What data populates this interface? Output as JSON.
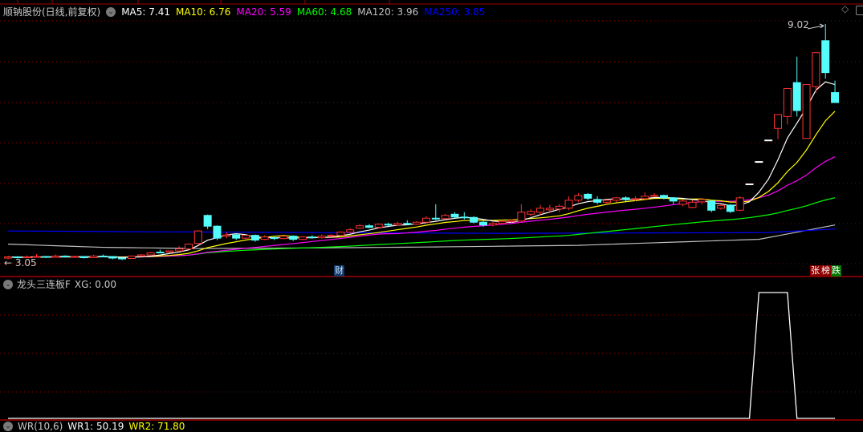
{
  "header": {
    "stock_name": "顺钠股份(日线,前复权)",
    "ma": [
      {
        "label": "MA5: 7.41",
        "color": "#ffffff"
      },
      {
        "label": "MA10: 6.76",
        "color": "#ffff00"
      },
      {
        "label": "MA20: 5.59",
        "color": "#ff00ff"
      },
      {
        "label": "MA60: 4.68",
        "color": "#00ff00"
      },
      {
        "label": "MA120: 3.96",
        "color": "#c0c0c0"
      },
      {
        "label": "MA250: 3.85",
        "color": "#0000ff"
      }
    ]
  },
  "main": {
    "high_label": "9.02",
    "low_label": "3.05",
    "finance_marker": "财",
    "tags": [
      {
        "label": "张",
        "color": "#8b0000"
      },
      {
        "label": "榜",
        "color": "#8b0000"
      },
      {
        "label": "跌",
        "color": "#007700"
      }
    ]
  },
  "sub": {
    "title": "龙头三连板F",
    "value": "XG: 0.00"
  },
  "bottom": {
    "items": [
      {
        "label": "WR(10,6)",
        "color": "#c8c8c8"
      },
      {
        "label": "WR1: 50.19",
        "color": "#ffffff"
      },
      {
        "label": "WR2: 71.80",
        "color": "#ffff00"
      }
    ]
  },
  "colors": {
    "up": "#ff3232",
    "down": "#54fcfc",
    "grid": "#8b0000"
  },
  "chart_data": {
    "type": "candlestick",
    "price_range": [
      3.05,
      9.46
    ],
    "candles_ohlc": [
      [
        3.15,
        3.2,
        3.12,
        3.18
      ],
      [
        3.18,
        3.2,
        3.14,
        3.16
      ],
      [
        3.16,
        3.22,
        3.15,
        3.18
      ],
      [
        3.18,
        3.25,
        3.16,
        3.19
      ],
      [
        3.19,
        3.2,
        3.15,
        3.17
      ],
      [
        3.17,
        3.24,
        3.16,
        3.2
      ],
      [
        3.2,
        3.22,
        3.16,
        3.18
      ],
      [
        3.18,
        3.21,
        3.17,
        3.19
      ],
      [
        3.19,
        3.2,
        3.14,
        3.16
      ],
      [
        3.16,
        3.23,
        3.15,
        3.2
      ],
      [
        3.2,
        3.24,
        3.18,
        3.19
      ],
      [
        3.19,
        3.2,
        3.12,
        3.15
      ],
      [
        3.15,
        3.17,
        3.1,
        3.14
      ],
      [
        3.14,
        3.22,
        3.13,
        3.2
      ],
      [
        3.2,
        3.25,
        3.19,
        3.23
      ],
      [
        3.23,
        3.3,
        3.22,
        3.28
      ],
      [
        3.3,
        3.36,
        3.27,
        3.29
      ],
      [
        3.3,
        3.34,
        3.28,
        3.33
      ],
      [
        3.33,
        3.45,
        3.32,
        3.38
      ],
      [
        3.38,
        3.52,
        3.37,
        3.5
      ],
      [
        3.52,
        3.85,
        3.48,
        3.83
      ],
      [
        4.22,
        4.24,
        3.88,
        3.95
      ],
      [
        3.95,
        3.97,
        3.6,
        3.65
      ],
      [
        3.7,
        3.8,
        3.65,
        3.73
      ],
      [
        3.73,
        3.76,
        3.6,
        3.65
      ],
      [
        3.65,
        3.74,
        3.63,
        3.72
      ],
      [
        3.72,
        3.74,
        3.56,
        3.6
      ],
      [
        3.62,
        3.72,
        3.6,
        3.68
      ],
      [
        3.66,
        3.7,
        3.6,
        3.64
      ],
      [
        3.64,
        3.72,
        3.62,
        3.7
      ],
      [
        3.7,
        3.72,
        3.58,
        3.62
      ],
      [
        3.62,
        3.7,
        3.6,
        3.68
      ],
      [
        3.68,
        3.72,
        3.64,
        3.66
      ],
      [
        3.66,
        3.74,
        3.64,
        3.7
      ],
      [
        3.7,
        3.75,
        3.68,
        3.72
      ],
      [
        3.72,
        3.82,
        3.7,
        3.8
      ],
      [
        3.8,
        3.9,
        3.78,
        3.86
      ],
      [
        3.9,
        4.0,
        3.88,
        3.96
      ],
      [
        3.96,
        4.0,
        3.9,
        3.92
      ],
      [
        3.92,
        4.02,
        3.9,
        4.0
      ],
      [
        4.0,
        4.04,
        3.95,
        3.98
      ],
      [
        3.98,
        4.06,
        3.96,
        4.02
      ],
      [
        4.02,
        4.1,
        3.98,
        4.0
      ],
      [
        4.0,
        4.08,
        3.98,
        4.05
      ],
      [
        4.05,
        4.2,
        4.03,
        4.15
      ],
      [
        4.15,
        4.5,
        4.1,
        4.14
      ],
      [
        4.14,
        4.26,
        4.12,
        4.22
      ],
      [
        4.25,
        4.3,
        4.15,
        4.18
      ],
      [
        4.18,
        4.3,
        4.12,
        4.17
      ],
      [
        4.17,
        4.2,
        4.02,
        4.05
      ],
      [
        4.05,
        4.08,
        3.94,
        3.98
      ],
      [
        3.98,
        4.05,
        3.95,
        4.02
      ],
      [
        4.02,
        4.1,
        4.0,
        4.07
      ],
      [
        4.07,
        4.12,
        4.02,
        4.1
      ],
      [
        4.08,
        4.5,
        4.05,
        4.3
      ],
      [
        4.25,
        4.38,
        4.2,
        4.32
      ],
      [
        4.3,
        4.48,
        4.22,
        4.4
      ],
      [
        4.36,
        4.48,
        4.3,
        4.4
      ],
      [
        4.38,
        4.5,
        4.3,
        4.45
      ],
      [
        4.4,
        4.7,
        4.35,
        4.6
      ],
      [
        4.6,
        4.78,
        4.55,
        4.72
      ],
      [
        4.75,
        4.78,
        4.6,
        4.65
      ],
      [
        4.62,
        4.7,
        4.5,
        4.55
      ],
      [
        4.55,
        4.62,
        4.5,
        4.6
      ],
      [
        4.6,
        4.68,
        4.55,
        4.66
      ],
      [
        4.66,
        4.7,
        4.55,
        4.62
      ],
      [
        4.62,
        4.7,
        4.58,
        4.64
      ],
      [
        4.64,
        4.8,
        4.6,
        4.7
      ],
      [
        4.72,
        4.78,
        4.72,
        4.72
      ],
      [
        4.72,
        4.74,
        4.62,
        4.66
      ],
      [
        4.66,
        4.68,
        4.5,
        4.58
      ],
      [
        4.5,
        4.62,
        4.45,
        4.58
      ],
      [
        4.42,
        4.6,
        4.4,
        4.55
      ],
      [
        4.56,
        4.64,
        4.5,
        4.62
      ],
      [
        4.58,
        4.6,
        4.3,
        4.35
      ],
      [
        4.4,
        4.5,
        4.36,
        4.47
      ],
      [
        4.48,
        4.5,
        4.28,
        4.32
      ],
      [
        4.35,
        4.7,
        4.33,
        4.66
      ],
      [
        5.0,
        5.0,
        5.0,
        5.0
      ],
      [
        5.56,
        5.56,
        5.56,
        5.56
      ],
      [
        6.1,
        6.1,
        6.1,
        6.1
      ],
      [
        6.4,
        6.75,
        6.13,
        6.75
      ],
      [
        6.7,
        7.4,
        6.5,
        7.4
      ],
      [
        7.55,
        8.2,
        6.7,
        6.85
      ],
      [
        6.15,
        7.5,
        6.15,
        7.5
      ],
      [
        7.45,
        8.3,
        7.3,
        8.3
      ],
      [
        8.6,
        9.02,
        7.65,
        7.8
      ],
      [
        7.3,
        7.6,
        7.05,
        7.05
      ]
    ],
    "candle_format": [
      "open",
      "high",
      "low",
      "close"
    ],
    "ma_windows": {
      "MA5": 5,
      "MA10": 10,
      "MA20": 20,
      "MA60": 60
    },
    "ma120": [
      [
        0,
        3.5
      ],
      [
        10,
        3.42
      ],
      [
        20,
        3.39
      ],
      [
        35,
        3.41
      ],
      [
        45,
        3.43
      ],
      [
        60,
        3.47
      ],
      [
        70,
        3.55
      ],
      [
        79,
        3.62
      ],
      [
        87,
        3.98
      ]
    ],
    "ma250": [
      [
        0,
        3.83
      ],
      [
        15,
        3.81
      ],
      [
        33,
        3.79
      ],
      [
        52,
        3.77
      ],
      [
        80,
        3.79
      ],
      [
        87,
        3.88
      ]
    ],
    "xg": [
      0,
      0,
      0,
      0,
      0,
      0,
      0,
      0,
      0,
      0,
      0,
      0,
      0,
      0,
      0,
      0,
      0,
      0,
      0,
      0,
      0,
      0,
      0,
      0,
      0,
      0,
      0,
      0,
      0,
      0,
      0,
      0,
      0,
      0,
      0,
      0,
      0,
      0,
      0,
      0,
      0,
      0,
      0,
      0,
      0,
      0,
      0,
      0,
      0,
      0,
      0,
      0,
      0,
      0,
      0,
      0,
      0,
      0,
      0,
      0,
      0,
      0,
      0,
      0,
      0,
      0,
      0,
      0,
      0,
      0,
      0,
      0,
      0,
      0,
      0,
      0,
      0,
      0,
      0,
      1,
      1,
      1,
      1,
      0,
      0,
      0,
      0,
      0
    ]
  }
}
